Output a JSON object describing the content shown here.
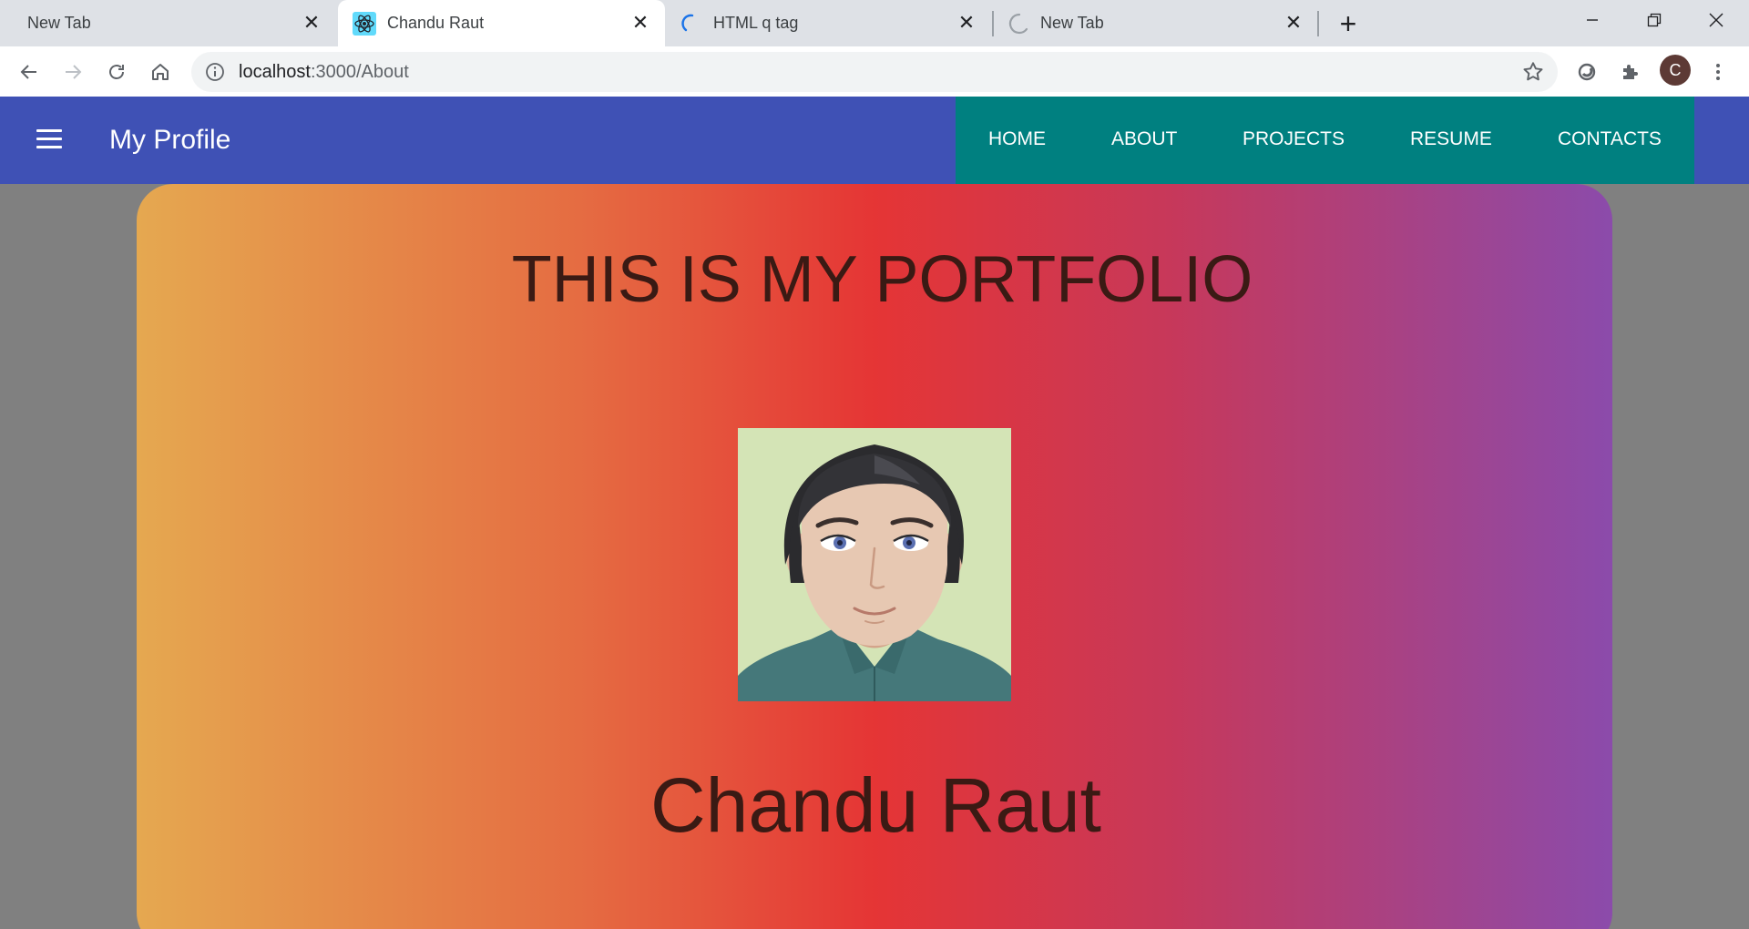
{
  "browser": {
    "tabs": [
      {
        "title": "New Tab",
        "icon": "none"
      },
      {
        "title": "Chandu Raut",
        "icon": "react-icon",
        "active": true
      },
      {
        "title": "HTML q tag",
        "icon": "loading-spinner-icon"
      },
      {
        "title": "New Tab",
        "icon": "loading-spinner-icon"
      }
    ],
    "address": {
      "host": "localhost",
      "path": ":3000/About"
    },
    "profile_initial": "C"
  },
  "appbar": {
    "title": "My Profile",
    "background": "#3f51b5",
    "nav_background": "#008080",
    "nav": [
      "HOME",
      "ABOUT",
      "PROJECTS",
      "RESUME",
      "CONTACTS"
    ]
  },
  "hero": {
    "title": "THIS IS MY PORTFOLIO",
    "name": "Chandu Raut",
    "gradient": [
      "#e5a850",
      "#e53535",
      "#8b4bab"
    ]
  }
}
